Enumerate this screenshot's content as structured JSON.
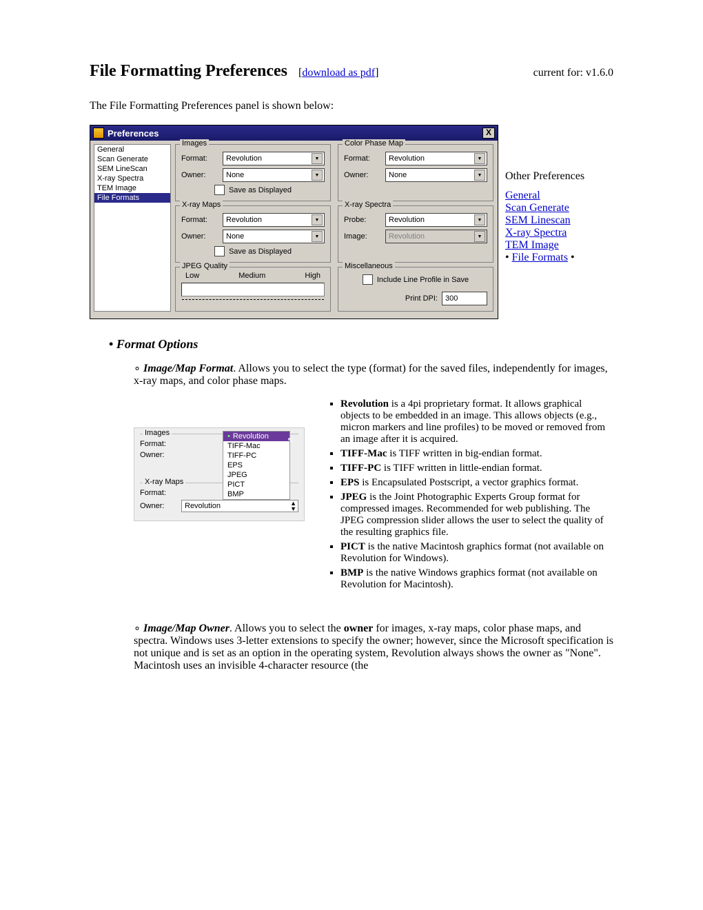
{
  "header": {
    "title": "File Formatting Preferences",
    "download_label": "download as pdf",
    "version_prefix": "current for: ",
    "version": "v1.6.0"
  },
  "intro": "The File Formatting Preferences panel is shown below:",
  "pref_window": {
    "title": "Preferences",
    "sidebar": [
      "General",
      "Scan Generate",
      "SEM LineScan",
      "X-ray Spectra",
      "TEM Image",
      "File Formats"
    ],
    "selected_index": 5,
    "groups": {
      "images": {
        "legend": "Images",
        "format": "Revolution",
        "owner": "None",
        "save_as_displayed": "Save as Displayed"
      },
      "color_phase_map": {
        "legend": "Color Phase Map",
        "format": "Revolution",
        "owner": "None"
      },
      "xray_maps": {
        "legend": "X-ray Maps",
        "format": "Revolution",
        "owner": "None",
        "save_as_displayed": "Save as Displayed"
      },
      "xray_spectra": {
        "legend": "X-ray Spectra",
        "probe": "Revolution",
        "image": "Revolution"
      },
      "jpeg": {
        "legend": "JPEG Quality",
        "low": "Low",
        "medium": "Medium",
        "high": "High"
      },
      "misc": {
        "legend": "Miscellaneous",
        "include_line": "Include Line Profile in Save",
        "print_dpi_label": "Print DPI:",
        "print_dpi": "300"
      }
    },
    "labels": {
      "format": "Format:",
      "owner": "Owner:",
      "probe": "Probe:",
      "image": "Image:"
    }
  },
  "right_nav": {
    "header": "Other Preferences",
    "items": [
      "General",
      "Scan Generate",
      "SEM Linescan",
      "X-ray Spectra",
      "TEM Image"
    ],
    "current": "File Formats"
  },
  "section": {
    "heading": "Format Options",
    "image_map_format": {
      "title": "Image/Map Format",
      "body": ". Allows you to select the type (format) for the saved files, independently for images, x-ray maps, and color phase maps."
    },
    "dropdown_mock": {
      "images_legend": "Images",
      "xray_legend": "X-ray Maps",
      "format_label": "Format:",
      "owner_label": "Owner:",
      "options": [
        "Revolution",
        "TIFF-Mac",
        "TIFF-PC",
        "EPS",
        "JPEG",
        "PICT",
        "BMP"
      ],
      "selected": "Revolution",
      "xray_format_value": "Revolution"
    },
    "format_descriptions": [
      {
        "name": "Revolution",
        "text": " is a 4pi proprietary format. It allows graphical objects to be embedded in an image. This allows objects (e.g., micron markers and line profiles) to be moved or removed from an image after it is acquired."
      },
      {
        "name": "TIFF-Mac",
        "text": " is TIFF written in big-endian format."
      },
      {
        "name": "TIFF-PC",
        "text": " is TIFF written in little-endian format."
      },
      {
        "name": "EPS",
        "text": " is Encapsulated Postscript, a vector graphics format."
      },
      {
        "name": "JPEG",
        "text": " is the Joint Photographic Experts Group format for compressed images. Recommended for web publishing. The JPEG compression slider allows the user to select the quality of the resulting graphics file."
      },
      {
        "name": "PICT",
        "text": " is the native Macintosh graphics format (not available on Revolution for Windows)."
      },
      {
        "name": "BMP",
        "text": " is the native Windows graphics format (not available on Revolution for Macintosh)."
      }
    ],
    "image_map_owner": {
      "title": "Image/Map Owner",
      "body_before": ". Allows you to select the ",
      "owner_word": "owner",
      "body_after": " for images, x-ray maps, color phase maps, and spectra. Windows uses 3-letter extensions to specify the owner; however, since the Microsoft specification is not unique and is set as an option in the operating system, Revolution always shows the owner as \"None\". Macintosh uses an invisible 4-character resource (the"
    }
  }
}
